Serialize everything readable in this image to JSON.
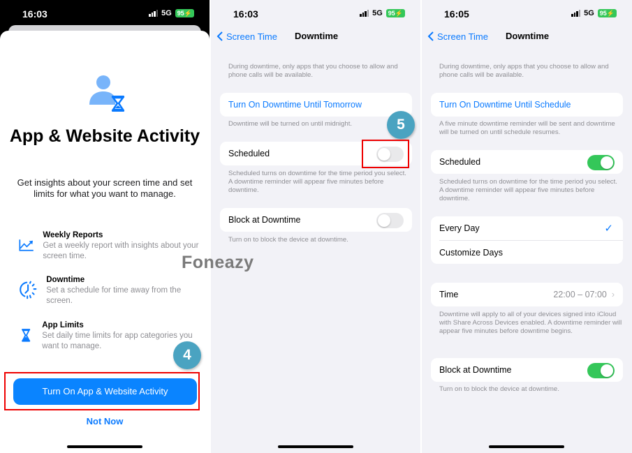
{
  "screen1": {
    "status": {
      "time": "16:03",
      "network": "5G",
      "battery": "95"
    },
    "title": "App & Website Activity",
    "subtitle": "Get insights about your screen time and set limits for what you want to manage.",
    "features": [
      {
        "icon": "chart-trend-icon",
        "title": "Weekly Reports",
        "desc": "Get a weekly report with insights about your screen time."
      },
      {
        "icon": "downtime-clock-icon",
        "title": "Downtime",
        "desc": "Set a schedule for time away from the screen."
      },
      {
        "icon": "hourglass-icon",
        "title": "App Limits",
        "desc": "Set daily time limits for app categories you want to manage."
      }
    ],
    "primary_button": "Turn On App & Website Activity",
    "secondary_button": "Not Now",
    "step_badge": "4"
  },
  "screen2": {
    "status": {
      "time": "16:03",
      "network": "5G",
      "battery": "95"
    },
    "back_label": "Screen Time",
    "nav_title": "Downtime",
    "intro": "During downtime, only apps that you choose to allow and phone calls will be available.",
    "turn_on_link": "Turn On Downtime Until Tomorrow",
    "turn_on_note": "Downtime will be turned on until midnight.",
    "scheduled_label": "Scheduled",
    "scheduled_on": false,
    "scheduled_note": "Scheduled turns on downtime for the time period you select. A downtime reminder will appear five minutes before downtime.",
    "block_label": "Block at Downtime",
    "block_on": false,
    "block_note": "Turn on to block the device at downtime.",
    "step_badge": "5"
  },
  "screen3": {
    "status": {
      "time": "16:05",
      "network": "5G",
      "battery": "95"
    },
    "back_label": "Screen Time",
    "nav_title": "Downtime",
    "intro": "During downtime, only apps that you choose to allow and phone calls will be available.",
    "turn_on_link": "Turn On Downtime Until Schedule",
    "turn_on_note": "A five minute downtime reminder will be sent and downtime will be turned on until schedule resumes.",
    "scheduled_label": "Scheduled",
    "scheduled_on": true,
    "scheduled_note": "Scheduled turns on downtime for the time period you select. A downtime reminder will appear five minutes before downtime.",
    "days_options": [
      "Every Day",
      "Customize Days"
    ],
    "days_selected": "Every Day",
    "time_label": "Time",
    "time_value": "22:00 – 07:00",
    "time_note": "Downtime will apply to all of your devices signed into iCloud with Share Across Devices enabled. A downtime reminder will appear five minutes before downtime begins.",
    "block_label": "Block at Downtime",
    "block_on": true,
    "block_note": "Turn on to block the device at downtime."
  },
  "watermark": "Foneazy",
  "colors": {
    "accent": "#0a7aff",
    "toggle_on": "#34c759",
    "highlight": "#e00000",
    "badge": "#4aa3c1"
  }
}
